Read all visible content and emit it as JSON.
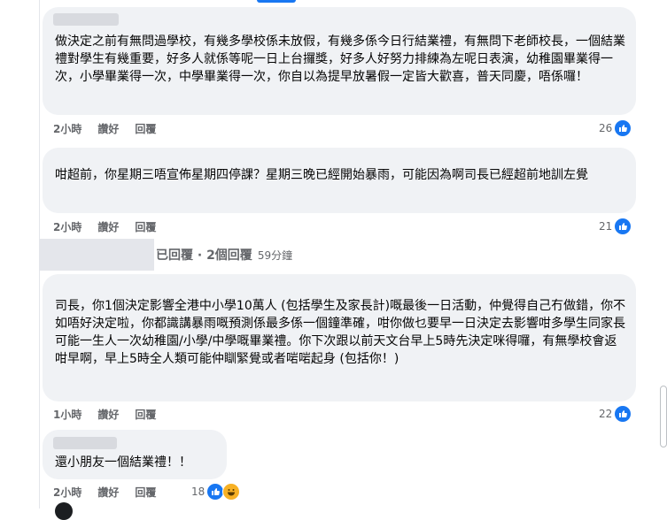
{
  "comments": [
    {
      "text": "做決定之前有無問過學校，有幾多學校係未放假，有幾多係今日行結業禮，有無問下老師校長，一個結業禮對學生有幾重要，好多人就係等呢一日上台攞獎，好多人好努力排練為左呢日表演，幼稚園畢業得一次，小學畢業得一次，中學畢業得一次，你自以為提早放暑假一定皆大歡喜，普天同慶，唔係囉！",
      "time": "2小時",
      "like_label": "讚好",
      "reply_label": "回覆",
      "reactions": "26"
    },
    {
      "text": "咁超前，你星期三唔宣佈星期四停課？星期三晚已經開始暴雨，可能因為啊司長已經超前地訓左覺",
      "time": "2小時",
      "like_label": "讚好",
      "reply_label": "回覆",
      "reactions": "21"
    },
    {
      "text": "司長，你1個決定影響全港中小學10萬人 (包括學生及家長計)嘅最後一日活動，仲覺得自己冇做錯，你不如唔好決定啦，你都識講暴雨嘅預測係最多係一個鐘準確，咁你做乜要早一日決定去影響咁多學生同家長可能一生人一次幼稚園/小學/中學嘅畢業禮。你下次跟以前天文台早上5時先決定咪得囉，有無學校會返咁早啊，早上5時全人類可能仲瞓緊覺或者啱啱起身 (包括你！)",
      "time": "1小時",
      "like_label": "讚好",
      "reply_label": "回覆",
      "reactions": "22"
    },
    {
      "text": "還小朋友一個結業禮！！",
      "time": "2小時",
      "like_label": "讚好",
      "reply_label": "回覆",
      "reactions": "18"
    }
  ],
  "reply_summary": {
    "label": "已回覆 · 2個回覆",
    "time": "59分鐘"
  },
  "colors": {
    "bubble": "#f0f2f5",
    "like": "#1877f2",
    "meta": "#65676b"
  },
  "icons": [
    "like-icon",
    "haha-icon"
  ]
}
